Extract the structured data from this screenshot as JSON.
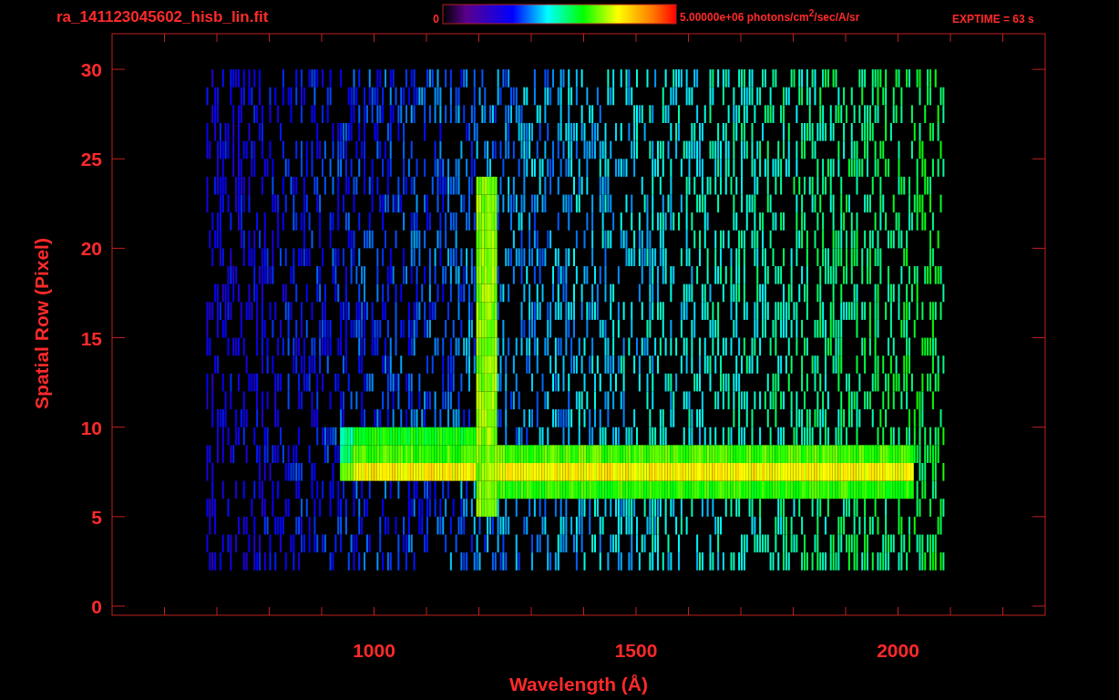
{
  "title": "ra_141123045602_hisb_lin.fit",
  "colorbar": {
    "min_label": "0",
    "max_label": "5.00000e+06 photons/cm$^{2}$/sec/A/sr"
  },
  "exposure": "EXPTIME = 63 s",
  "y_axis": {
    "label": "Spatial Row (Pixel)",
    "ticks": [
      "30",
      "25",
      "20",
      "15",
      "10",
      "5",
      "0"
    ]
  },
  "x_axis": {
    "label": "Wavelength (Å)",
    "ticks": [
      "1000",
      "1500",
      "2000"
    ]
  }
}
